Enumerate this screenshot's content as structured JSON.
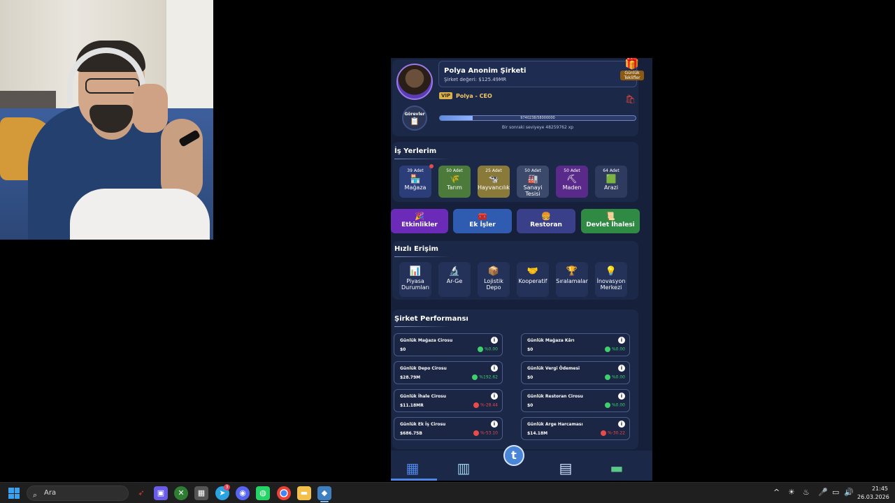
{
  "profile": {
    "company_name": "Polya Anonim Şirketi",
    "company_value": "Şirket değeri: $125.49MR",
    "vip": "VIP",
    "role": "Polya - CEO",
    "missions_label": "Görevler",
    "daily_offer": "Günlük Teklifler",
    "xp_text": "9740238/58000000",
    "xp_progress": 0.168,
    "next_level": "Bir sonraki seviyeye 48259762 xp"
  },
  "workplaces": {
    "title": "İş Yerlerim",
    "items": [
      {
        "count": "39 Adet",
        "label": "Mağaza",
        "icon": "store-icon",
        "color": "#2b3e7a"
      },
      {
        "count": "50 Adet",
        "label": "Tarım",
        "icon": "farm-icon",
        "color": "#4b7a3a"
      },
      {
        "count": "25 Adet",
        "label": "Hayvancılık",
        "icon": "livestock-icon",
        "color": "#8a7a3a"
      },
      {
        "count": "50 Adet",
        "label": "Sanayi Tesisi",
        "icon": "factory-icon",
        "color": "#3b4a6a"
      },
      {
        "count": "50 Adet",
        "label": "Maden",
        "icon": "mine-icon",
        "color": "#5a2a8a"
      },
      {
        "count": "64 Adet",
        "label": "Arazi",
        "icon": "land-icon",
        "color": "#2e3b5e"
      }
    ]
  },
  "big_buttons": [
    {
      "label": "Etkinlikler",
      "icon": "events-icon",
      "color": "#6b2bb8"
    },
    {
      "label": "Ek İşler",
      "icon": "side-jobs-icon",
      "color": "#2f5bb0"
    },
    {
      "label": "Restoran",
      "icon": "restaurant-icon",
      "color": "#3a3f8a"
    },
    {
      "label": "Devlet İhalesi",
      "icon": "tender-icon",
      "color": "#2f8a44"
    }
  ],
  "quick_access": {
    "title": "Hızlı Erişim",
    "items": [
      {
        "label": "Piyasa Durumları",
        "icon": "market-chart-icon"
      },
      {
        "label": "Ar-Ge",
        "icon": "research-icon"
      },
      {
        "label": "Lojistik Depo",
        "icon": "warehouse-icon"
      },
      {
        "label": "Kooperatif",
        "icon": "handshake-icon"
      },
      {
        "label": "Sıralamalar",
        "icon": "ranking-icon"
      },
      {
        "label": "İnovasyon Merkezi",
        "icon": "innovation-icon"
      }
    ]
  },
  "performance": {
    "title": "Şirket Performansı",
    "items": [
      {
        "label": "Günlük Mağaza Cirosu",
        "value": "$0",
        "change": "%0.00",
        "trend": "up"
      },
      {
        "label": "Günlük Mağaza Kârı",
        "value": "$0",
        "change": "%0.00",
        "trend": "up"
      },
      {
        "label": "Günlük Depo Cirosu",
        "value": "$28.79M",
        "change": "%192.62",
        "trend": "up"
      },
      {
        "label": "Günlük Vergi Ödemesi",
        "value": "$0",
        "change": "%0.00",
        "trend": "up"
      },
      {
        "label": "Günlük İhale Cirosu",
        "value": "$11.18MR",
        "change": "%-28.44",
        "trend": "down"
      },
      {
        "label": "Günlük Restoran Cirosu",
        "value": "$0",
        "change": "%0.00",
        "trend": "up"
      },
      {
        "label": "Günlük Ek İş Cirosu",
        "value": "$686.75B",
        "change": "%-53.10",
        "trend": "down"
      },
      {
        "label": "Günlük Arge Harcaması",
        "value": "$14.18M",
        "change": "%-30.22",
        "trend": "down"
      }
    ]
  },
  "bottom_nav": [
    "dashboard-icon",
    "buildings-icon",
    "home-center-icon",
    "city-icon",
    "money-icon"
  ],
  "taskbar": {
    "search_placeholder": "Ara",
    "telegram_badge": "3",
    "time": "21:45",
    "date": "26.03.2026"
  }
}
